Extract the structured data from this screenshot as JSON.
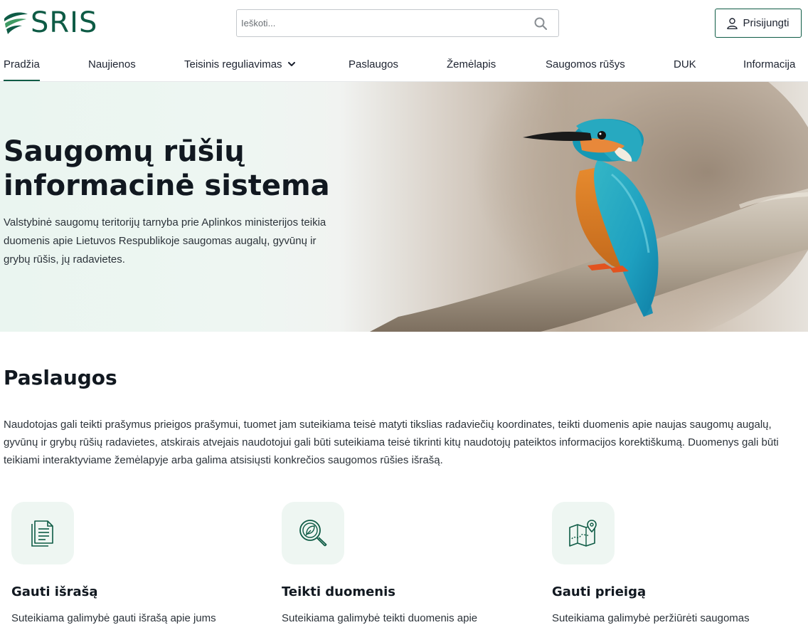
{
  "header": {
    "logo_text": "SRIS",
    "search_placeholder": "Ieškoti...",
    "login_label": "Prisijungti"
  },
  "nav": {
    "items": [
      {
        "label": "Pradžia",
        "active": true
      },
      {
        "label": "Naujienos"
      },
      {
        "label": "Teisinis reguliavimas",
        "has_dropdown": true
      },
      {
        "label": "Paslaugos"
      },
      {
        "label": "Žemėlapis"
      },
      {
        "label": "Saugomos rūšys"
      },
      {
        "label": "DUK"
      },
      {
        "label": "Informacija"
      }
    ]
  },
  "hero": {
    "title_line1": "Saugomų rūšių",
    "title_line2": "informacinė sistema",
    "description": "Valstybinė saugomų teritorijų tarnyba prie Aplinkos ministerijos teikia duomenis apie Lietuvos Respublikoje saugomas augalų, gyvūnų ir grybų rūšis, jų radavietes."
  },
  "services": {
    "title": "Paslaugos",
    "description": "Naudotojas gali teikti prašymus prieigos prašymui, tuomet jam suteikiama teisė matyti tikslias radaviečių koordinates, teikti duomenis apie naujas saugomų augalų, gyvūnų ir grybų rūšių radavietes, atskirais atvejais naudotojui gali būti suteikiama teisė tikrinti kitų naudotojų pateiktos informacijos korektiškumą. Duomenys gali būti teikiami interaktyviame žemėlapyje arba galima atsisiųsti konkrečios saugomos rūšies išrašą.",
    "cards": [
      {
        "title": "Gauti išrašą",
        "description": "Suteikiama galimybė gauti išrašą apie jums",
        "icon": "document-icon"
      },
      {
        "title": "Teikti duomenis",
        "description": "Suteikiama galimybė teikti duomenis apie",
        "icon": "search-leaf-icon"
      },
      {
        "title": "Gauti prieigą",
        "description": "Suteikiama galimybė peržiūrėti saugomas",
        "icon": "map-pin-icon"
      }
    ]
  },
  "colors": {
    "brand": "#0e5b45",
    "icon_bg": "#eef6f2",
    "text": "#1d2330"
  }
}
